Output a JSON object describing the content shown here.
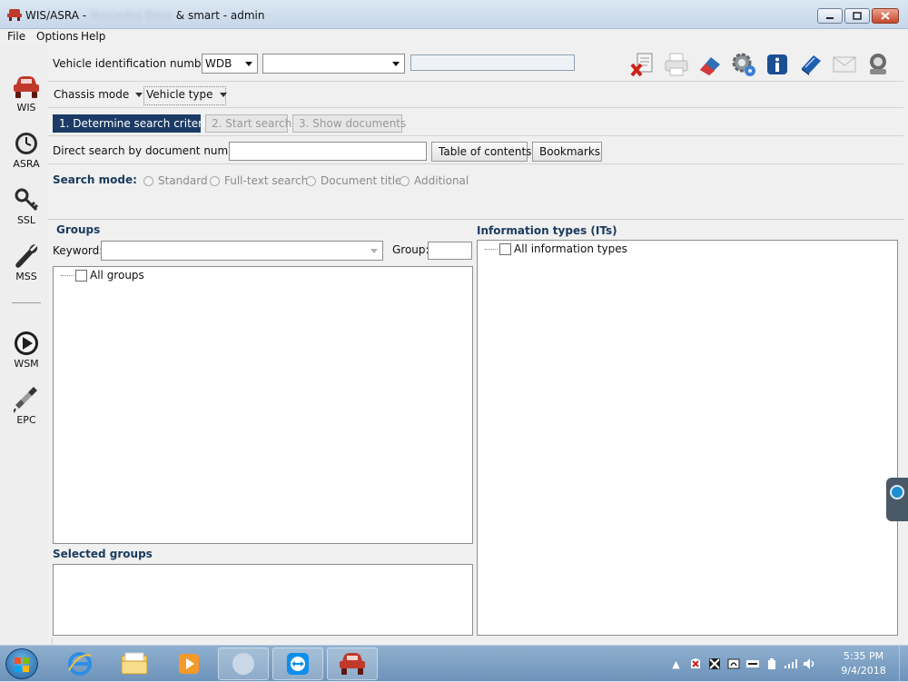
{
  "window": {
    "title": "WIS/ASRA - ",
    "title_blurred": "Mercedes-Benz",
    "title_suffix": " & smart - admin"
  },
  "menu": [
    "File",
    "Options",
    "Help"
  ],
  "sidebar": [
    {
      "label": "WIS",
      "icon": "car-icon"
    },
    {
      "label": "ASRA",
      "icon": "clock-icon"
    },
    {
      "label": "SSL",
      "icon": "key-icon"
    },
    {
      "label": "MSS",
      "icon": "wrench-icon"
    },
    {
      "label": "WSM",
      "icon": "play-icon"
    },
    {
      "label": "EPC",
      "icon": "spark-plug-icon"
    }
  ],
  "vin": {
    "label": "Vehicle identification number",
    "prefix_value": "WDB",
    "vin_value": "",
    "extra_value": ""
  },
  "toolbar": [
    "delete-document-icon",
    "print-icon",
    "eraser-icon",
    "settings-icon",
    "info-icon",
    "book-icon",
    "mail-icon",
    "network-icon"
  ],
  "mode": {
    "chassis_label": "Chassis mode",
    "vehicle_label": "Vehicle type"
  },
  "steps": [
    {
      "label": "1. Determine search criteria",
      "active": true
    },
    {
      "label": "2. Start search",
      "active": false
    },
    {
      "label": "3. Show documents",
      "active": false
    }
  ],
  "direct": {
    "label": "Direct search by document number:",
    "value": "",
    "toc_label": "Table of contents",
    "bookmarks_label": "Bookmarks"
  },
  "search_mode": {
    "label": "Search mode:",
    "options": [
      "Standard",
      "Full-text search",
      "Document title",
      "Additional"
    ]
  },
  "groups": {
    "title": "Groups",
    "keyword_label": "Keyword:",
    "keyword_value": "",
    "group_label": "Group:",
    "group_value": "",
    "tree_root": "All groups"
  },
  "selected_groups": {
    "title": "Selected groups"
  },
  "info_types": {
    "title": "Information types (ITs)",
    "tree_root": "All information types"
  },
  "taskbar": {
    "time": "5:35 PM",
    "date": "9/4/2018"
  },
  "colors": {
    "accent": "#1b3b66",
    "section_title": "#1a3a5e",
    "taskbar": "#7fa3c8"
  }
}
